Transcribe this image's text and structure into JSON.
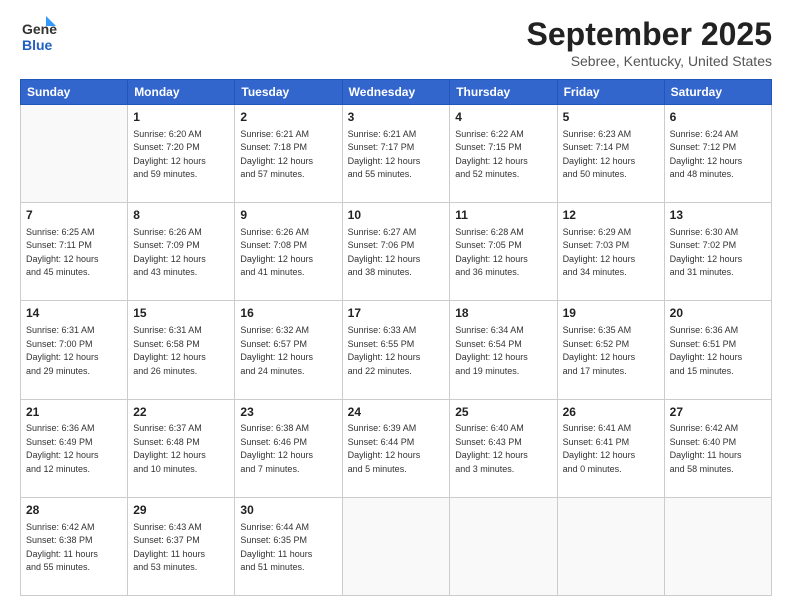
{
  "header": {
    "logo": {
      "line1": "General",
      "line2": "Blue"
    },
    "title": "September 2025",
    "location": "Sebree, Kentucky, United States"
  },
  "weekdays": [
    "Sunday",
    "Monday",
    "Tuesday",
    "Wednesday",
    "Thursday",
    "Friday",
    "Saturday"
  ],
  "weeks": [
    [
      {
        "day": "",
        "info": ""
      },
      {
        "day": "1",
        "info": "Sunrise: 6:20 AM\nSunset: 7:20 PM\nDaylight: 12 hours\nand 59 minutes."
      },
      {
        "day": "2",
        "info": "Sunrise: 6:21 AM\nSunset: 7:18 PM\nDaylight: 12 hours\nand 57 minutes."
      },
      {
        "day": "3",
        "info": "Sunrise: 6:21 AM\nSunset: 7:17 PM\nDaylight: 12 hours\nand 55 minutes."
      },
      {
        "day": "4",
        "info": "Sunrise: 6:22 AM\nSunset: 7:15 PM\nDaylight: 12 hours\nand 52 minutes."
      },
      {
        "day": "5",
        "info": "Sunrise: 6:23 AM\nSunset: 7:14 PM\nDaylight: 12 hours\nand 50 minutes."
      },
      {
        "day": "6",
        "info": "Sunrise: 6:24 AM\nSunset: 7:12 PM\nDaylight: 12 hours\nand 48 minutes."
      }
    ],
    [
      {
        "day": "7",
        "info": "Sunrise: 6:25 AM\nSunset: 7:11 PM\nDaylight: 12 hours\nand 45 minutes."
      },
      {
        "day": "8",
        "info": "Sunrise: 6:26 AM\nSunset: 7:09 PM\nDaylight: 12 hours\nand 43 minutes."
      },
      {
        "day": "9",
        "info": "Sunrise: 6:26 AM\nSunset: 7:08 PM\nDaylight: 12 hours\nand 41 minutes."
      },
      {
        "day": "10",
        "info": "Sunrise: 6:27 AM\nSunset: 7:06 PM\nDaylight: 12 hours\nand 38 minutes."
      },
      {
        "day": "11",
        "info": "Sunrise: 6:28 AM\nSunset: 7:05 PM\nDaylight: 12 hours\nand 36 minutes."
      },
      {
        "day": "12",
        "info": "Sunrise: 6:29 AM\nSunset: 7:03 PM\nDaylight: 12 hours\nand 34 minutes."
      },
      {
        "day": "13",
        "info": "Sunrise: 6:30 AM\nSunset: 7:02 PM\nDaylight: 12 hours\nand 31 minutes."
      }
    ],
    [
      {
        "day": "14",
        "info": "Sunrise: 6:31 AM\nSunset: 7:00 PM\nDaylight: 12 hours\nand 29 minutes."
      },
      {
        "day": "15",
        "info": "Sunrise: 6:31 AM\nSunset: 6:58 PM\nDaylight: 12 hours\nand 26 minutes."
      },
      {
        "day": "16",
        "info": "Sunrise: 6:32 AM\nSunset: 6:57 PM\nDaylight: 12 hours\nand 24 minutes."
      },
      {
        "day": "17",
        "info": "Sunrise: 6:33 AM\nSunset: 6:55 PM\nDaylight: 12 hours\nand 22 minutes."
      },
      {
        "day": "18",
        "info": "Sunrise: 6:34 AM\nSunset: 6:54 PM\nDaylight: 12 hours\nand 19 minutes."
      },
      {
        "day": "19",
        "info": "Sunrise: 6:35 AM\nSunset: 6:52 PM\nDaylight: 12 hours\nand 17 minutes."
      },
      {
        "day": "20",
        "info": "Sunrise: 6:36 AM\nSunset: 6:51 PM\nDaylight: 12 hours\nand 15 minutes."
      }
    ],
    [
      {
        "day": "21",
        "info": "Sunrise: 6:36 AM\nSunset: 6:49 PM\nDaylight: 12 hours\nand 12 minutes."
      },
      {
        "day": "22",
        "info": "Sunrise: 6:37 AM\nSunset: 6:48 PM\nDaylight: 12 hours\nand 10 minutes."
      },
      {
        "day": "23",
        "info": "Sunrise: 6:38 AM\nSunset: 6:46 PM\nDaylight: 12 hours\nand 7 minutes."
      },
      {
        "day": "24",
        "info": "Sunrise: 6:39 AM\nSunset: 6:44 PM\nDaylight: 12 hours\nand 5 minutes."
      },
      {
        "day": "25",
        "info": "Sunrise: 6:40 AM\nSunset: 6:43 PM\nDaylight: 12 hours\nand 3 minutes."
      },
      {
        "day": "26",
        "info": "Sunrise: 6:41 AM\nSunset: 6:41 PM\nDaylight: 12 hours\nand 0 minutes."
      },
      {
        "day": "27",
        "info": "Sunrise: 6:42 AM\nSunset: 6:40 PM\nDaylight: 11 hours\nand 58 minutes."
      }
    ],
    [
      {
        "day": "28",
        "info": "Sunrise: 6:42 AM\nSunset: 6:38 PM\nDaylight: 11 hours\nand 55 minutes."
      },
      {
        "day": "29",
        "info": "Sunrise: 6:43 AM\nSunset: 6:37 PM\nDaylight: 11 hours\nand 53 minutes."
      },
      {
        "day": "30",
        "info": "Sunrise: 6:44 AM\nSunset: 6:35 PM\nDaylight: 11 hours\nand 51 minutes."
      },
      {
        "day": "",
        "info": ""
      },
      {
        "day": "",
        "info": ""
      },
      {
        "day": "",
        "info": ""
      },
      {
        "day": "",
        "info": ""
      }
    ]
  ]
}
